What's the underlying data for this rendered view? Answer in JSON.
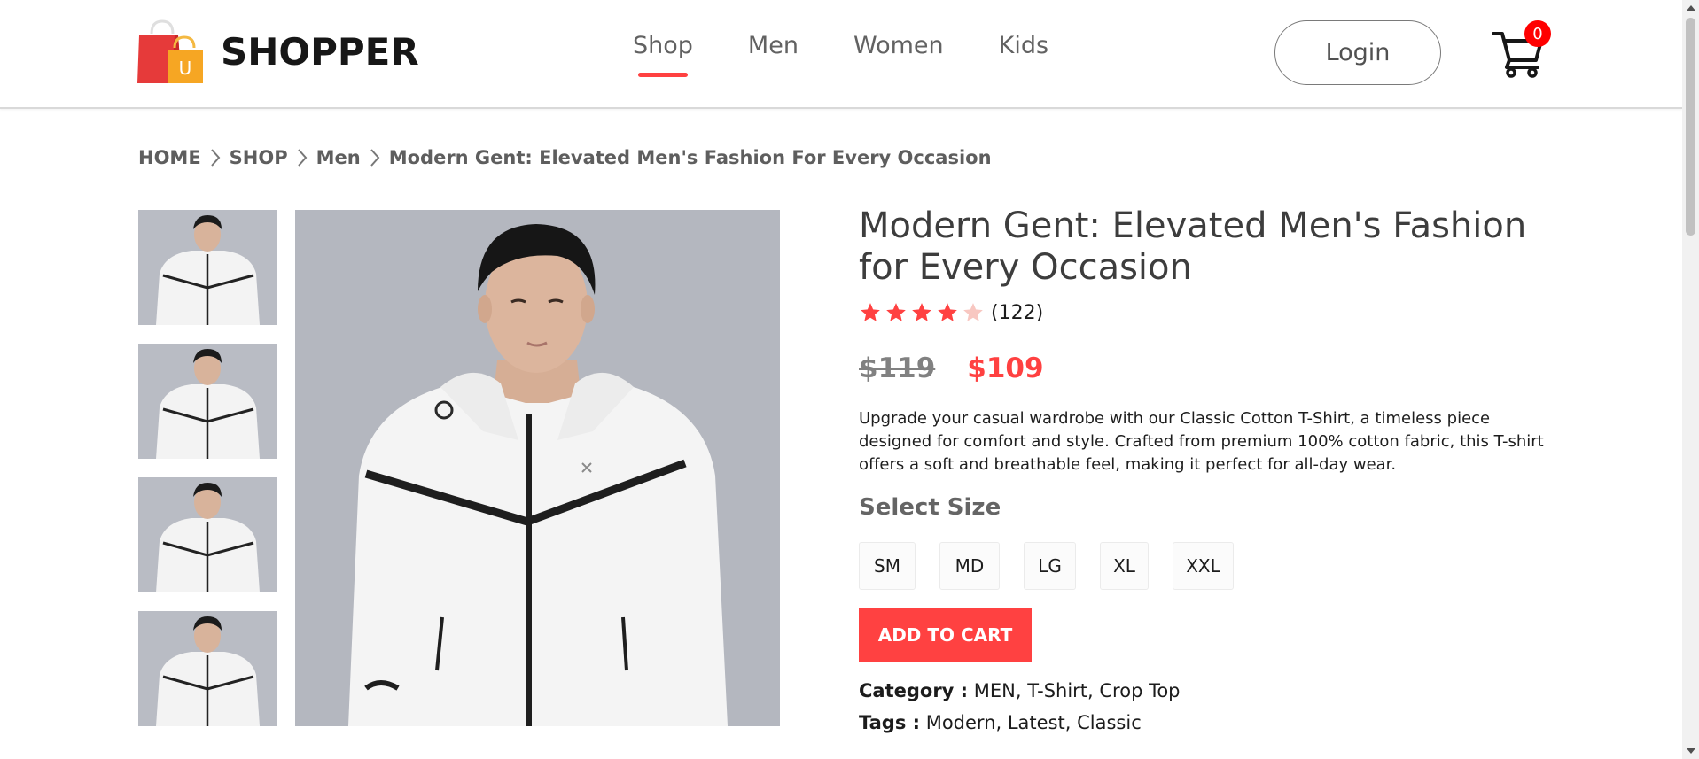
{
  "navbar": {
    "brand": "SHOPPER",
    "logo_letter": "U",
    "menu": [
      {
        "label": "Shop",
        "active": true
      },
      {
        "label": "Men",
        "active": false
      },
      {
        "label": "Women",
        "active": false
      },
      {
        "label": "Kids",
        "active": false
      }
    ],
    "login_label": "Login",
    "cart_count": "0",
    "cart_icon": "cart-icon",
    "accent_color": "#ff4141"
  },
  "breadcrumb": [
    "HOME",
    "SHOP",
    "Men",
    "Modern Gent: Elevated Men's Fashion For Every Occasion"
  ],
  "gallery": {
    "thumbnail_count": 4
  },
  "product": {
    "title": "Modern Gent: Elevated Men's Fashion for Every Occasion",
    "rating_stars": 4,
    "rating_max": 5,
    "review_count": "(122)",
    "old_price": "$119",
    "new_price": "$109",
    "description": "Upgrade your casual wardrobe with our Classic Cotton T-Shirt, a timeless piece designed for comfort and style. Crafted from premium 100% cotton fabric, this T-shirt offers a soft and breathable feel, making it perfect for all-day wear.",
    "size_heading": "Select Size",
    "sizes": [
      "SM",
      "MD",
      "LG",
      "XL",
      "XXL"
    ],
    "add_to_cart_label": "ADD TO CART",
    "category_label": "Category :",
    "category_value": "MEN, T-Shirt, Crop Top",
    "tags_label": "Tags :",
    "tags_value": "Modern, Latest, Classic",
    "star_color": "#ff4141"
  }
}
